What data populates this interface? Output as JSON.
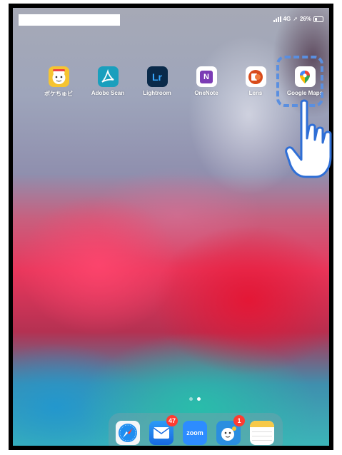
{
  "status_bar": {
    "signal": "4G",
    "battery": "26%"
  },
  "apps": [
    {
      "label": "ポケちゅビ",
      "icon": "character-face-icon"
    },
    {
      "label": "Adobe Scan",
      "icon": "adobe-scan-icon"
    },
    {
      "label": "Lightroom",
      "icon_text": "Lr"
    },
    {
      "label": "OneNote",
      "icon_text": "N"
    },
    {
      "label": "Lens",
      "icon": "office-lens-icon"
    },
    {
      "label": "Google Maps",
      "icon": "map-pin-icon"
    }
  ],
  "page_dots": {
    "count": 2,
    "active": 1
  },
  "dock": {
    "apps": [
      {
        "name": "Safari",
        "icon": "compass-icon"
      },
      {
        "name": "Mail",
        "icon": "envelope-icon",
        "badge": "47"
      },
      {
        "name": "Zoom",
        "icon_text": "zoom"
      },
      {
        "name": "Character app",
        "icon": "character-icon",
        "badge": "1"
      },
      {
        "name": "Notes",
        "icon": "notes-icon"
      }
    ]
  },
  "annotation": {
    "highlight": "Google Maps",
    "pointer": "pointing-hand-icon"
  },
  "colors": {
    "adobe": "#1a9fbd",
    "lightroom": "#0a2a4a",
    "lightroom_text": "#38a8ff",
    "onenote": "#7b3bb5",
    "lens": "#d84a1b",
    "highlight": "#5a8fe0",
    "badge": "#ff3b30",
    "zoom": "#2d8cff"
  }
}
